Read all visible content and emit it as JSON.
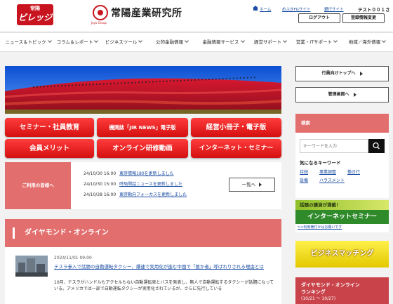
{
  "header": {
    "village_logo_small": "常陽",
    "village_logo_big": "ビレッジ",
    "logo_name": "常陽産業研究所",
    "logo_sub": "Joyo Group",
    "links": [
      "ホーム",
      "めぶきFGサイト",
      "銀行サイト"
    ],
    "user": "テスト００１さん",
    "logout": "ログアウト",
    "account": "登録情報変更"
  },
  "nav": [
    "ニュース＆トピック",
    "コラム＆レポート",
    "ビジネスツール",
    "公的金融情報",
    "金融情報サービス",
    "経営サポート",
    "営業・ITサポート",
    "地域／海外情報"
  ],
  "buttons": [
    "セミナー・社員教育",
    "機関誌「JIR NEWS」電子版",
    "経営小冊子・電子版",
    "会員メリット",
    "オンライン研修動画",
    "インターネット・セミナー"
  ],
  "notice": {
    "label": "ご利用の皆様へ",
    "items": [
      {
        "date": "24/10/30 16:00",
        "text": "東芽情報180を更新しました"
      },
      {
        "date": "24/10/30 15:00",
        "text": "時局閑話ニュースを更新しました"
      },
      {
        "date": "24/10/28 16:00",
        "text": "東芽動向フォーカスを更新しました"
      }
    ],
    "more": "一覧へ"
  },
  "section": {
    "title": "ダイヤモンド・オンライン"
  },
  "article": {
    "date": "2024/11/01 09:00",
    "title": "テスラ参入で話題の自動運転タクシー、爆速で実用化が進む中国で「悪か者」呼ばれりされる理由とは",
    "body": "10月、テスラがハンドルもアクセルもない自動運転車とバスを発表し、無人で自動運転するタクシーが話題になっている。アメリカでは一部で自動運転タクシーが実用化されているが、さらに先行している"
  },
  "sidebar": {
    "bank_top": "行員向けトップへ",
    "admin": "管理画面へ",
    "search_title": "検索",
    "search_placeholder": "キーワードを入力",
    "keywords_title": "気になるキーワード",
    "keywords": [
      "持続",
      "事業調整",
      "働き行",
      "設備",
      "ハラスメント"
    ],
    "banner1_top": "話題の講演が満載！",
    "banner1_main": "インターネットセミナー",
    "banner1_link": ">>利用権付けはお願いです",
    "banner2": "ビジネスマッチング",
    "rank_title1": "ダイヤモンド・オンライン",
    "rank_title2": "ランキング",
    "rank_period": "(10/21 ～ 10/27)"
  },
  "colors": {
    "accent": "#c8141e",
    "pink": "#e36e6e",
    "link": "#1a4da3"
  }
}
